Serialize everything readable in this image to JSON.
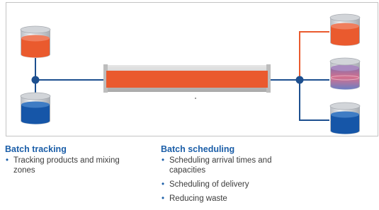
{
  "colors": {
    "orange": "#ea5a2e",
    "blue": "#1656a8",
    "line_blue": "#1d4f8f",
    "frame": "#c4c4c4",
    "heading": "#1b5ea8"
  },
  "diagram": {
    "tanks_left": [
      {
        "id": "left-top",
        "fill": "orange"
      },
      {
        "id": "left-bottom",
        "fill": "blue"
      }
    ],
    "tanks_right": [
      {
        "id": "right-top",
        "fill": "orange"
      },
      {
        "id": "right-middle",
        "fill": "mixed"
      },
      {
        "id": "right-bottom",
        "fill": "blue"
      }
    ],
    "pipe_fill": "orange"
  },
  "sections": {
    "tracking": {
      "title": "Batch tracking",
      "items": [
        "Tracking products and mixing zones"
      ]
    },
    "scheduling": {
      "title": "Batch scheduling",
      "items": [
        "Scheduling arrival times and capacities",
        "Scheduling of delivery",
        "Reducing waste"
      ]
    }
  }
}
